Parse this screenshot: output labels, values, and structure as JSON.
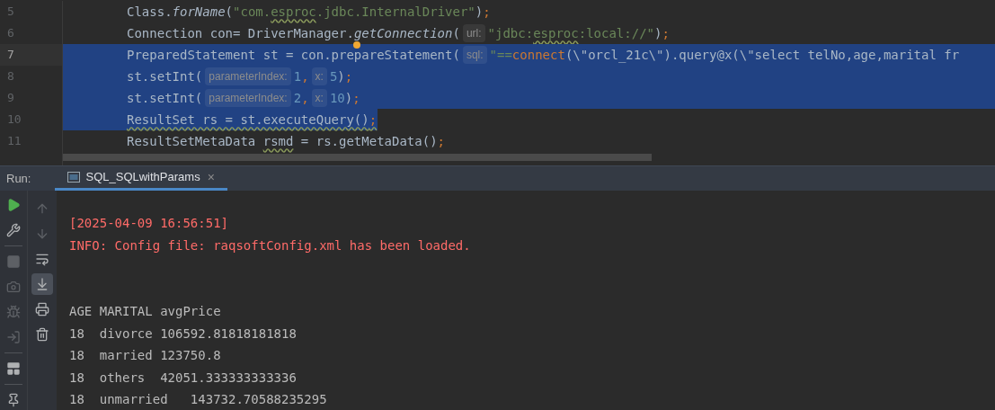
{
  "editor": {
    "lines": [
      {
        "number": "5",
        "current": false,
        "selected": false,
        "tokens": [
          {
            "text": "Class.",
            "kind": "plain"
          },
          {
            "text": "forName",
            "kind": "italic"
          },
          {
            "text": "(",
            "kind": "plain"
          },
          {
            "text": "\"com.",
            "kind": "string"
          },
          {
            "text": "esproc",
            "kind": "string",
            "warn": true
          },
          {
            "text": ".jdbc.InternalDriver\"",
            "kind": "string"
          },
          {
            "text": ")",
            "kind": "plain"
          },
          {
            "text": ";",
            "kind": "keyword"
          }
        ]
      },
      {
        "number": "6",
        "current": false,
        "selected": false,
        "tokens": [
          {
            "text": "Connection con= DriverManager.",
            "kind": "plain"
          },
          {
            "text": "getConnection",
            "kind": "italic"
          },
          {
            "text": "(",
            "kind": "plain"
          },
          {
            "text": "url:",
            "kind": "hint"
          },
          {
            "text": "\"jdbc:",
            "kind": "string"
          },
          {
            "text": "esproc",
            "kind": "string",
            "warn": true
          },
          {
            "text": ":local://\"",
            "kind": "string"
          },
          {
            "text": ")",
            "kind": "plain"
          },
          {
            "text": ";",
            "kind": "keyword"
          }
        ]
      },
      {
        "number": "7",
        "current": true,
        "selected": true,
        "tokens": [
          {
            "text": "PreparedStatement st = con.prepareStatement(",
            "kind": "plain"
          },
          {
            "text": "sql:",
            "kind": "hint"
          },
          {
            "text": "\"==",
            "kind": "string"
          },
          {
            "text": "connect",
            "kind": "keyword"
          },
          {
            "text": "(\\\"orcl_21c\\\").query@x(\\\"select telNo,age,marital fr",
            "kind": "plain"
          }
        ]
      },
      {
        "number": "8",
        "current": false,
        "selected": true,
        "tokens": [
          {
            "text": "st.setInt(",
            "kind": "plain"
          },
          {
            "text": "parameterIndex:",
            "kind": "hint"
          },
          {
            "text": "1",
            "kind": "number"
          },
          {
            "text": ",",
            "kind": "keyword"
          },
          {
            "text": "x:",
            "kind": "hint"
          },
          {
            "text": "5",
            "kind": "number"
          },
          {
            "text": ")",
            "kind": "plain"
          },
          {
            "text": ";",
            "kind": "keyword"
          }
        ]
      },
      {
        "number": "9",
        "current": false,
        "selected": true,
        "tokens": [
          {
            "text": "st.setInt(",
            "kind": "plain"
          },
          {
            "text": "parameterIndex:",
            "kind": "hint"
          },
          {
            "text": "2",
            "kind": "number"
          },
          {
            "text": ",",
            "kind": "keyword"
          },
          {
            "text": "x:",
            "kind": "hint"
          },
          {
            "text": "10",
            "kind": "number"
          },
          {
            "text": ")",
            "kind": "plain"
          },
          {
            "text": ";",
            "kind": "keyword"
          }
        ]
      },
      {
        "number": "10",
        "current": false,
        "selected": true,
        "tokens": [
          {
            "text": "ResultSet rs = st.executeQuery()",
            "kind": "plain",
            "warn": true
          },
          {
            "text": ";",
            "kind": "keyword",
            "warn": true
          }
        ]
      },
      {
        "number": "11",
        "current": false,
        "selected": false,
        "tokens": [
          {
            "text": "ResultSetMetaData ",
            "kind": "plain"
          },
          {
            "text": "rsmd",
            "kind": "plain",
            "warn": true
          },
          {
            "text": " = rs.getMetaData()",
            "kind": "plain"
          },
          {
            "text": ";",
            "kind": "keyword"
          }
        ]
      }
    ]
  },
  "run_panel": {
    "label": "Run:",
    "tabs": [
      {
        "label": "SQL_SQLwithParams",
        "selected": true,
        "close": "×"
      }
    ],
    "toolbar_main": [
      {
        "kind": "run",
        "disabled": false
      },
      {
        "kind": "settings",
        "disabled": false
      },
      {
        "kind": "separator"
      },
      {
        "kind": "stop",
        "disabled": true
      },
      {
        "kind": "camera",
        "disabled": true
      },
      {
        "kind": "debug",
        "disabled": true
      },
      {
        "kind": "exit",
        "disabled": true
      },
      {
        "kind": "separator"
      },
      {
        "kind": "layout",
        "disabled": false
      },
      {
        "kind": "separator"
      },
      {
        "kind": "pin",
        "disabled": false
      }
    ],
    "toolbar_console": [
      {
        "kind": "up",
        "disabled": true,
        "selected": false
      },
      {
        "kind": "down",
        "disabled": true,
        "selected": false
      },
      {
        "kind": "wrap",
        "disabled": false,
        "selected": false
      },
      {
        "kind": "scroll_end",
        "disabled": false,
        "selected": true
      },
      {
        "kind": "print",
        "disabled": false,
        "selected": false
      },
      {
        "kind": "trash",
        "disabled": false,
        "selected": false
      }
    ],
    "console": {
      "messages": [
        "[2025-04-09 16:56:51]",
        "INFO: Config file: raqsoftConfig.xml has been loaded."
      ],
      "output": [
        "AGE MARITAL avgPrice",
        "18  divorce 106592.81818181818",
        "18  married 123750.8",
        "18  others  42051.333333333336",
        "18  unmarried   143732.70588235295"
      ]
    }
  }
}
